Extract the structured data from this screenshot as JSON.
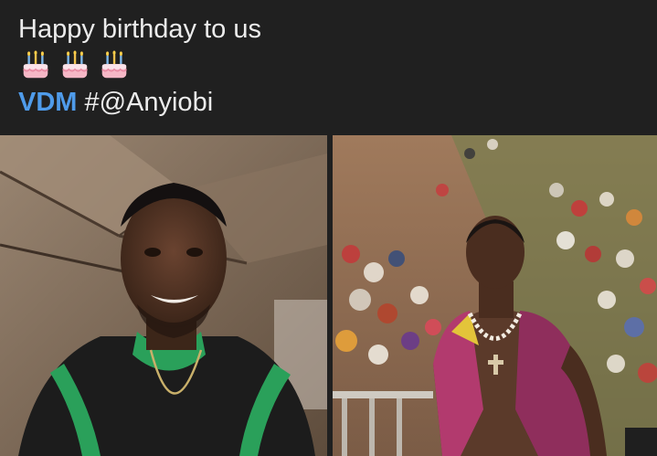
{
  "post": {
    "title_line": "Happy birthday to us",
    "cake_icons": [
      "birthday-cake",
      "birthday-cake",
      "birthday-cake"
    ],
    "mention": "VDM",
    "hashtag": "#@Anyiobi"
  },
  "colors": {
    "background": "#202020",
    "text": "#ececec",
    "mention": "#4f9bea"
  },
  "photos": [
    {
      "description_name": "selfie-photo"
    },
    {
      "description_name": "crowd-portrait-photo"
    }
  ]
}
